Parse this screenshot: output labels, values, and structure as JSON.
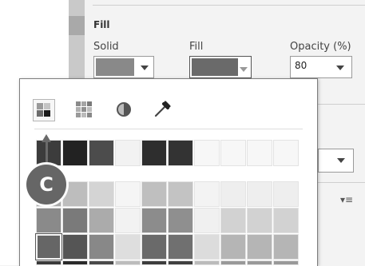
{
  "fill": {
    "section_title": "Fill",
    "solid_label": "Solid",
    "fill_label": "Fill",
    "opacity_label": "Opacity (%)",
    "opacity_value": "80"
  },
  "callout": {
    "letter": "C"
  },
  "palette": {
    "tools": [
      "color-palette-icon",
      "swatch-grid-icon",
      "contrast-icon",
      "eyedropper-icon"
    ],
    "theme_row": [
      "#3c3c3c",
      "#222222",
      "#4c4c4c",
      "#f2f2f2",
      "#2e2e2e",
      "#333333",
      "#f7f7f7",
      "#f7f7f7",
      "#f7f7f7",
      "#f7f7f7"
    ],
    "tint_rows": [
      [
        "#a9a9a9",
        "#bdbdbd",
        "#d4d4d4",
        "#f5f5f5",
        "#bfbfbf",
        "#c3c3c3",
        "#f3f3f3",
        "#eeeeee",
        "#eeeeee",
        "#eeeeee"
      ],
      [
        "#8a8a8a",
        "#7a7a7a",
        "#ababab",
        "#f2f2f2",
        "#8c8c8c",
        "#8f8f8f",
        "#f0f0f0",
        "#d2d2d2",
        "#d2d2d2",
        "#d2d2d2"
      ],
      [
        "#666666",
        "#555555",
        "#888888",
        "#dedede",
        "#6a6a6a",
        "#707070",
        "#dcdcdc",
        "#b5b5b5",
        "#b5b5b5",
        "#b5b5b5"
      ],
      [
        "#3a3a3a",
        "#2a2a2a",
        "#4a4a4a",
        "#bcbcbc",
        "#3d3d3d",
        "#404040",
        "#bbbbbb",
        "#999999",
        "#999999",
        "#999999"
      ]
    ]
  },
  "colors": {
    "solid_swatch": "#898989",
    "fill_swatch": "#6a6a6a",
    "callout": "#666666"
  }
}
